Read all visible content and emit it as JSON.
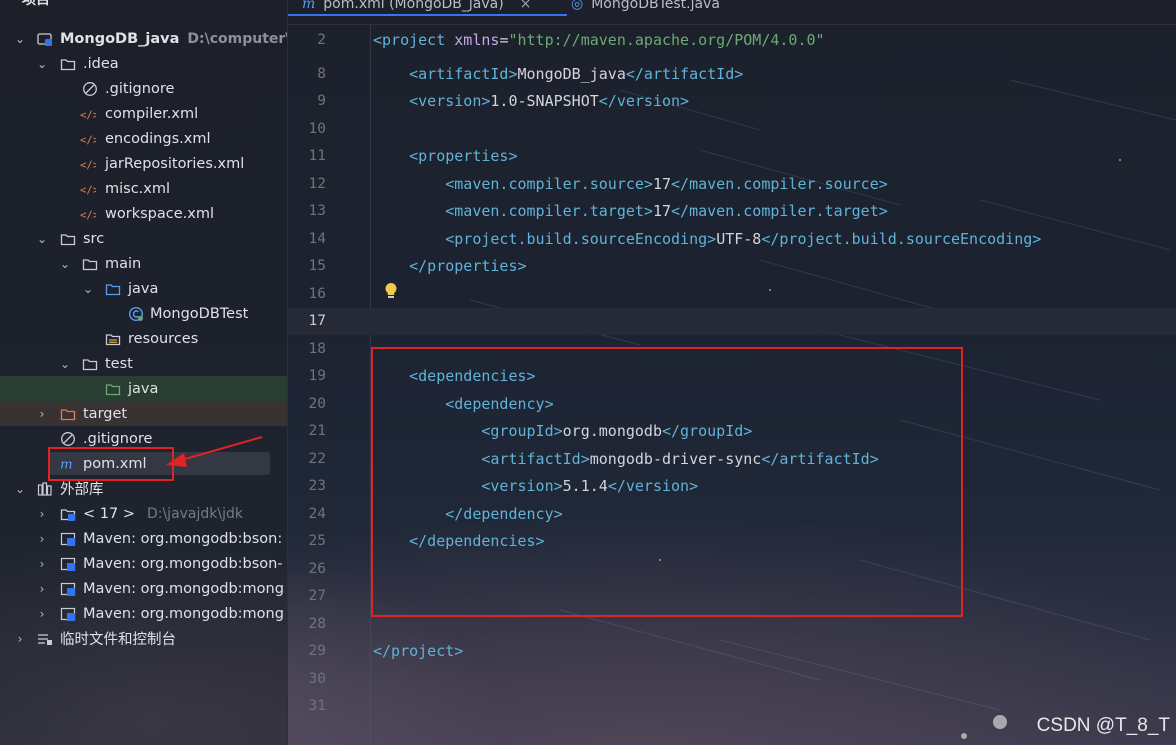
{
  "project_panel": {
    "header": {
      "title": "项目"
    },
    "tree": [
      {
        "label": "MongoDB_java",
        "path": "D:\\computer\\j"
      },
      {
        "label": ".idea"
      },
      {
        "label": ".gitignore"
      },
      {
        "label": "compiler.xml"
      },
      {
        "label": "encodings.xml"
      },
      {
        "label": "jarRepositories.xml"
      },
      {
        "label": "misc.xml"
      },
      {
        "label": "workspace.xml"
      },
      {
        "label": "src"
      },
      {
        "label": "main"
      },
      {
        "label": "java"
      },
      {
        "label": "MongoDBTest"
      },
      {
        "label": "resources"
      },
      {
        "label": "test"
      },
      {
        "label": "java"
      },
      {
        "label": "target"
      },
      {
        "label": ".gitignore"
      },
      {
        "label": "pom.xml"
      },
      {
        "label": "外部库"
      },
      {
        "label": "< 17 >",
        "path": "D:\\javajdk\\jdk"
      },
      {
        "label": "Maven: org.mongodb:bson:"
      },
      {
        "label": "Maven: org.mongodb:bson-"
      },
      {
        "label": "Maven: org.mongodb:mong"
      },
      {
        "label": "Maven: org.mongodb:mong"
      },
      {
        "label": "临时文件和控制台"
      }
    ]
  },
  "tabs": [
    {
      "label": "pom.xml (MongoDB_java)",
      "active": true
    },
    {
      "label": "MongoDBTest.java",
      "active": false
    }
  ],
  "editor": {
    "current_line": "17",
    "lines": [
      {
        "num": "2"
      },
      {
        "num": "8"
      },
      {
        "num": "9"
      },
      {
        "num": "10"
      },
      {
        "num": "11"
      },
      {
        "num": "12"
      },
      {
        "num": "13"
      },
      {
        "num": "14"
      },
      {
        "num": "15"
      },
      {
        "num": "16"
      },
      {
        "num": "17"
      },
      {
        "num": "18"
      },
      {
        "num": "19"
      },
      {
        "num": "20"
      },
      {
        "num": "21"
      },
      {
        "num": "22"
      },
      {
        "num": "23"
      },
      {
        "num": "24"
      },
      {
        "num": "25"
      },
      {
        "num": "26"
      },
      {
        "num": "27"
      },
      {
        "num": "28"
      },
      {
        "num": "29"
      },
      {
        "num": "30"
      },
      {
        "num": "31"
      }
    ],
    "code": {
      "project_open_tag": "<project",
      "xmlns_attr": "xmlns",
      "xmlns_value": "\"http://maven.apache.org/POM/4.0.0\"",
      "artifactId_open": "<artifactId>",
      "artifactId_value": "MongoDB_java",
      "artifactId_close": "</artifactId>",
      "version_open": "<version>",
      "version_value": "1.0-SNAPSHOT",
      "version_close": "</version>",
      "properties_open": "<properties>",
      "source_open": "<maven.compiler.source>",
      "source_value": "17",
      "source_close": "</maven.compiler.source>",
      "target_open": "<maven.compiler.target>",
      "target_value": "17",
      "target_close": "</maven.compiler.target>",
      "encoding_open": "<project.build.sourceEncoding>",
      "encoding_value": "UTF-8",
      "encoding_close": "</project.build.sourceEncoding>",
      "properties_close": "</properties>",
      "dependencies_open": "<dependencies>",
      "dependency_open": "<dependency>",
      "groupId_open": "<groupId>",
      "groupId_value": "org.mongodb",
      "groupId_close": "</groupId>",
      "dep_artifactId_open": "<artifactId>",
      "dep_artifactId_value": "mongodb-driver-sync",
      "dep_artifactId_close": "</artifactId>",
      "dep_version_open": "<version>",
      "dep_version_value": "5.1.4",
      "dep_version_close": "</version>",
      "dependency_close": "</dependency>",
      "dependencies_close": "</dependencies>",
      "project_close": "</project>"
    }
  },
  "watermark": "CSDN @T_8_T",
  "colors": {
    "accent": "#3574f0",
    "annotation_red": "#e02424",
    "xml_tag": "#5fb3d8",
    "xml_attr": "#c7a8e8",
    "xml_value": "#6aab73"
  }
}
